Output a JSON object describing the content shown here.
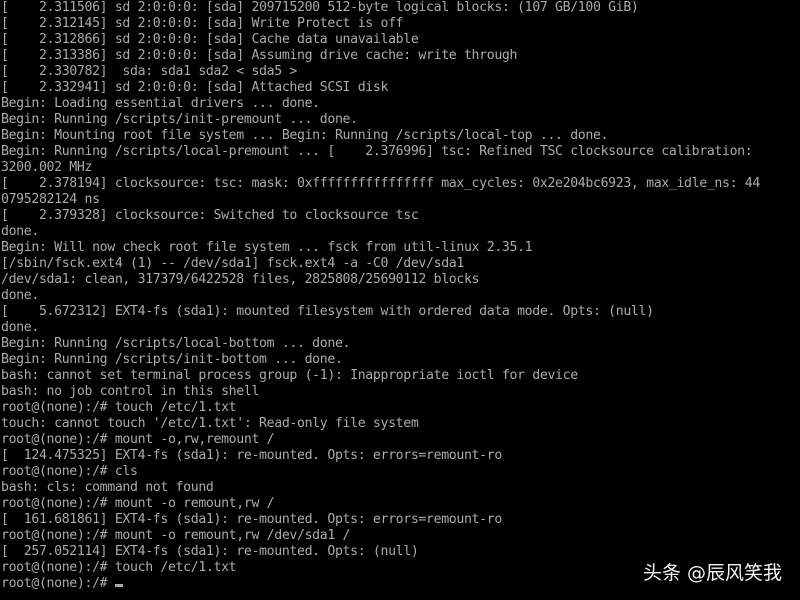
{
  "terminal": {
    "lines": [
      "[    2.311506] sd 2:0:0:0: [sda] 209715200 512-byte logical blocks: (107 GB/100 GiB)",
      "[    2.312145] sd 2:0:0:0: [sda] Write Protect is off",
      "[    2.312866] sd 2:0:0:0: [sda] Cache data unavailable",
      "[    2.313386] sd 2:0:0:0: [sda] Assuming drive cache: write through",
      "[    2.330782]  sda: sda1 sda2 < sda5 >",
      "[    2.332941] sd 2:0:0:0: [sda] Attached SCSI disk",
      "Begin: Loading essential drivers ... done.",
      "Begin: Running /scripts/init-premount ... done.",
      "Begin: Mounting root file system ... Begin: Running /scripts/local-top ... done.",
      "Begin: Running /scripts/local-premount ... [    2.376996] tsc: Refined TSC clocksource calibration:",
      "3200.002 MHz",
      "[    2.378194] clocksource: tsc: mask: 0xffffffffffffffff max_cycles: 0x2e204bc6923, max_idle_ns: 44",
      "0795282124 ns",
      "[    2.379328] clocksource: Switched to clocksource tsc",
      "done.",
      "Begin: Will now check root file system ... fsck from util-linux 2.35.1",
      "[/sbin/fsck.ext4 (1) -- /dev/sda1] fsck.ext4 -a -C0 /dev/sda1",
      "/dev/sda1: clean, 317379/6422528 files, 2825808/25690112 blocks",
      "done.",
      "[    5.672312] EXT4-fs (sda1): mounted filesystem with ordered data mode. Opts: (null)",
      "done.",
      "Begin: Running /scripts/local-bottom ... done.",
      "Begin: Running /scripts/init-bottom ... done.",
      "bash: cannot set terminal process group (-1): Inappropriate ioctl for device",
      "bash: no job control in this shell",
      "root@(none):/# touch /etc/1.txt",
      "touch: cannot touch '/etc/1.txt': Read-only file system",
      "root@(none):/# mount -o,rw,remount /",
      "[  124.475325] EXT4-fs (sda1): re-mounted. Opts: errors=remount-ro",
      "root@(none):/# cls",
      "bash: cls: command not found",
      "root@(none):/# mount -o remount,rw /",
      "[  161.681861] EXT4-fs (sda1): re-mounted. Opts: errors=remount-ro",
      "root@(none):/# mount -o remount,rw /dev/sda1 /",
      "[  257.052114] EXT4-fs (sda1): re-mounted. Opts: (null)",
      "root@(none):/# touch /etc/1.txt",
      "root@(none):/# "
    ]
  },
  "watermark": {
    "text": "头条 @辰风笑我"
  },
  "colors": {
    "background": "#000000",
    "text": "#aaaaaa",
    "watermark": "#ffffff"
  }
}
